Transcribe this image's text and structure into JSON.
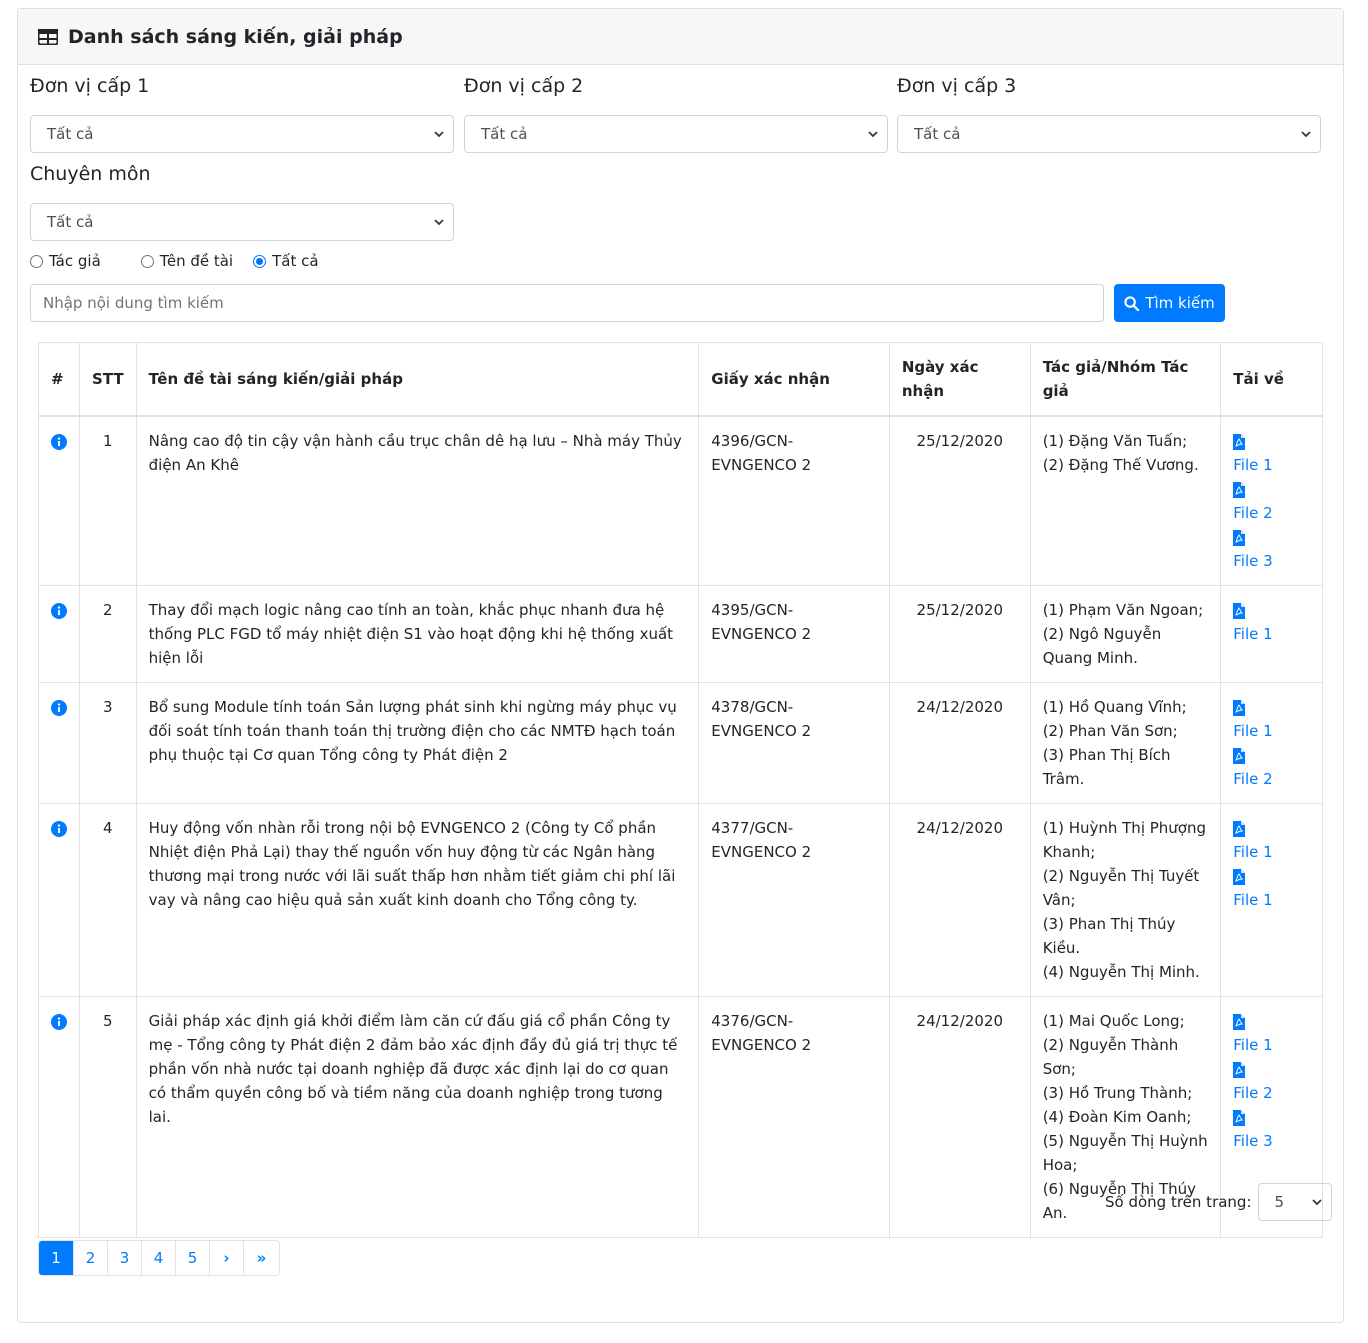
{
  "header": {
    "title": "Danh sách sáng kiến, giải pháp"
  },
  "filters": {
    "unit1": {
      "label": "Đơn vị cấp 1",
      "value": "Tất cả"
    },
    "unit2": {
      "label": "Đơn vị cấp 2",
      "value": "Tất cả"
    },
    "unit3": {
      "label": "Đơn vị cấp 3",
      "value": "Tất cả"
    },
    "specialty": {
      "label": "Chuyên môn",
      "value": "Tất cả"
    }
  },
  "search_mode": {
    "options": [
      "Tác giả",
      "Tên đề tài",
      "Tất cả"
    ],
    "selected": 2
  },
  "search": {
    "placeholder": "Nhập nội dung tìm kiếm",
    "button_label": "Tìm kiếm"
  },
  "table": {
    "columns": [
      "#",
      "STT",
      "Tên đề tài sáng kiến/giải pháp",
      "Giấy xác nhận",
      "Ngày xác nhận",
      "Tác giả/Nhóm Tác giả",
      "Tải về"
    ],
    "rows": [
      {
        "stt": "1",
        "title": "Nâng cao độ tin cậy vận hành cầu trục chân dê hạ lưu – Nhà máy Thủy điện An Khê",
        "cert": "4396/GCN-EVNGENCO 2",
        "date": "25/12/2020",
        "authors": [
          "(1) Đặng Văn Tuấn;",
          "(2) Đặng Thế Vương."
        ],
        "files": [
          "File 1",
          "File 2",
          "File 3"
        ]
      },
      {
        "stt": "2",
        "title": "Thay đổi mạch logic nâng cao tính an toàn, khắc phục nhanh đưa hệ thống PLC FGD tổ máy nhiệt điện S1 vào hoạt động khi hệ thống xuất hiện lỗi",
        "cert": "4395/GCN-EVNGENCO 2",
        "date": "25/12/2020",
        "authors": [
          "(1) Phạm Văn Ngoan;",
          "(2) Ngô Nguyễn Quang Minh."
        ],
        "files": [
          "File 1"
        ]
      },
      {
        "stt": "3",
        "title": "Bổ sung Module tính toán Sản lượng phát sinh khi ngừng máy phục vụ đối soát tính toán thanh toán thị trường điện cho các NMTĐ hạch toán phụ thuộc tại Cơ quan Tổng công ty Phát điện 2",
        "cert": "4378/GCN-EVNGENCO 2",
        "date": "24/12/2020",
        "authors": [
          "(1) Hồ Quang Vĩnh;",
          "(2) Phan Văn Sơn;",
          "(3) Phan Thị Bích Trâm."
        ],
        "files": [
          "File 1",
          "File 2"
        ]
      },
      {
        "stt": "4",
        "title": "Huy động vốn nhàn rỗi trong nội bộ EVNGENCO 2 (Công ty Cổ phần Nhiệt điện Phả Lại) thay thế nguồn vốn huy động từ các Ngân hàng thương mại trong nước với lãi suất thấp hơn nhằm tiết giảm chi phí lãi vay và nâng cao hiệu quả sản xuất kinh doanh cho Tổng công ty.",
        "cert": "4377/GCN-EVNGENCO 2",
        "date": "24/12/2020",
        "authors": [
          "(1) Huỳnh Thị Phượng Khanh;",
          "(2) Nguyễn Thị Tuyết Vân;",
          "(3) Phan Thị Thúy Kiều.",
          "(4) Nguyễn Thị Minh."
        ],
        "files": [
          "File 1",
          "File 1"
        ]
      },
      {
        "stt": "5",
        "title": "Giải pháp xác định giá khởi điểm làm căn cứ đấu giá cổ phần Công ty mẹ - Tổng công ty Phát điện 2 đảm bảo xác định đầy đủ giá trị thực tế phần vốn nhà nước tại doanh nghiệp đã được xác định lại do cơ quan có thẩm quyền công bố và tiềm năng của doanh nghiệp trong tương lai.",
        "cert": "4376/GCN-EVNGENCO 2",
        "date": "24/12/2020",
        "authors": [
          "(1) Mai Quốc Long;",
          "(2) Nguyễn Thành Sơn;",
          "(3) Hồ Trung Thành;",
          "(4) Đoàn Kim Oanh;",
          "(5) Nguyễn Thị Huỳnh Hoa;",
          "(6) Nguyễn Thị Thúy An."
        ],
        "files": [
          "File 1",
          "File 2",
          "File 3"
        ]
      }
    ]
  },
  "rows_per_page": {
    "label": "Số dòng trên trang:",
    "value": "5"
  },
  "pagination": {
    "pages": [
      "1",
      "2",
      "3",
      "4",
      "5"
    ],
    "active": "1",
    "next": "›",
    "last": "»"
  },
  "colors": {
    "primary": "#007bff",
    "border": "#dee2e6",
    "header_bg": "#f7f7f7"
  },
  "icons": {
    "header": "table-icon",
    "info": "info-circle-icon",
    "file": "pdf-file-icon",
    "search": "search-icon",
    "dropdown": "chevron-down-icon"
  }
}
